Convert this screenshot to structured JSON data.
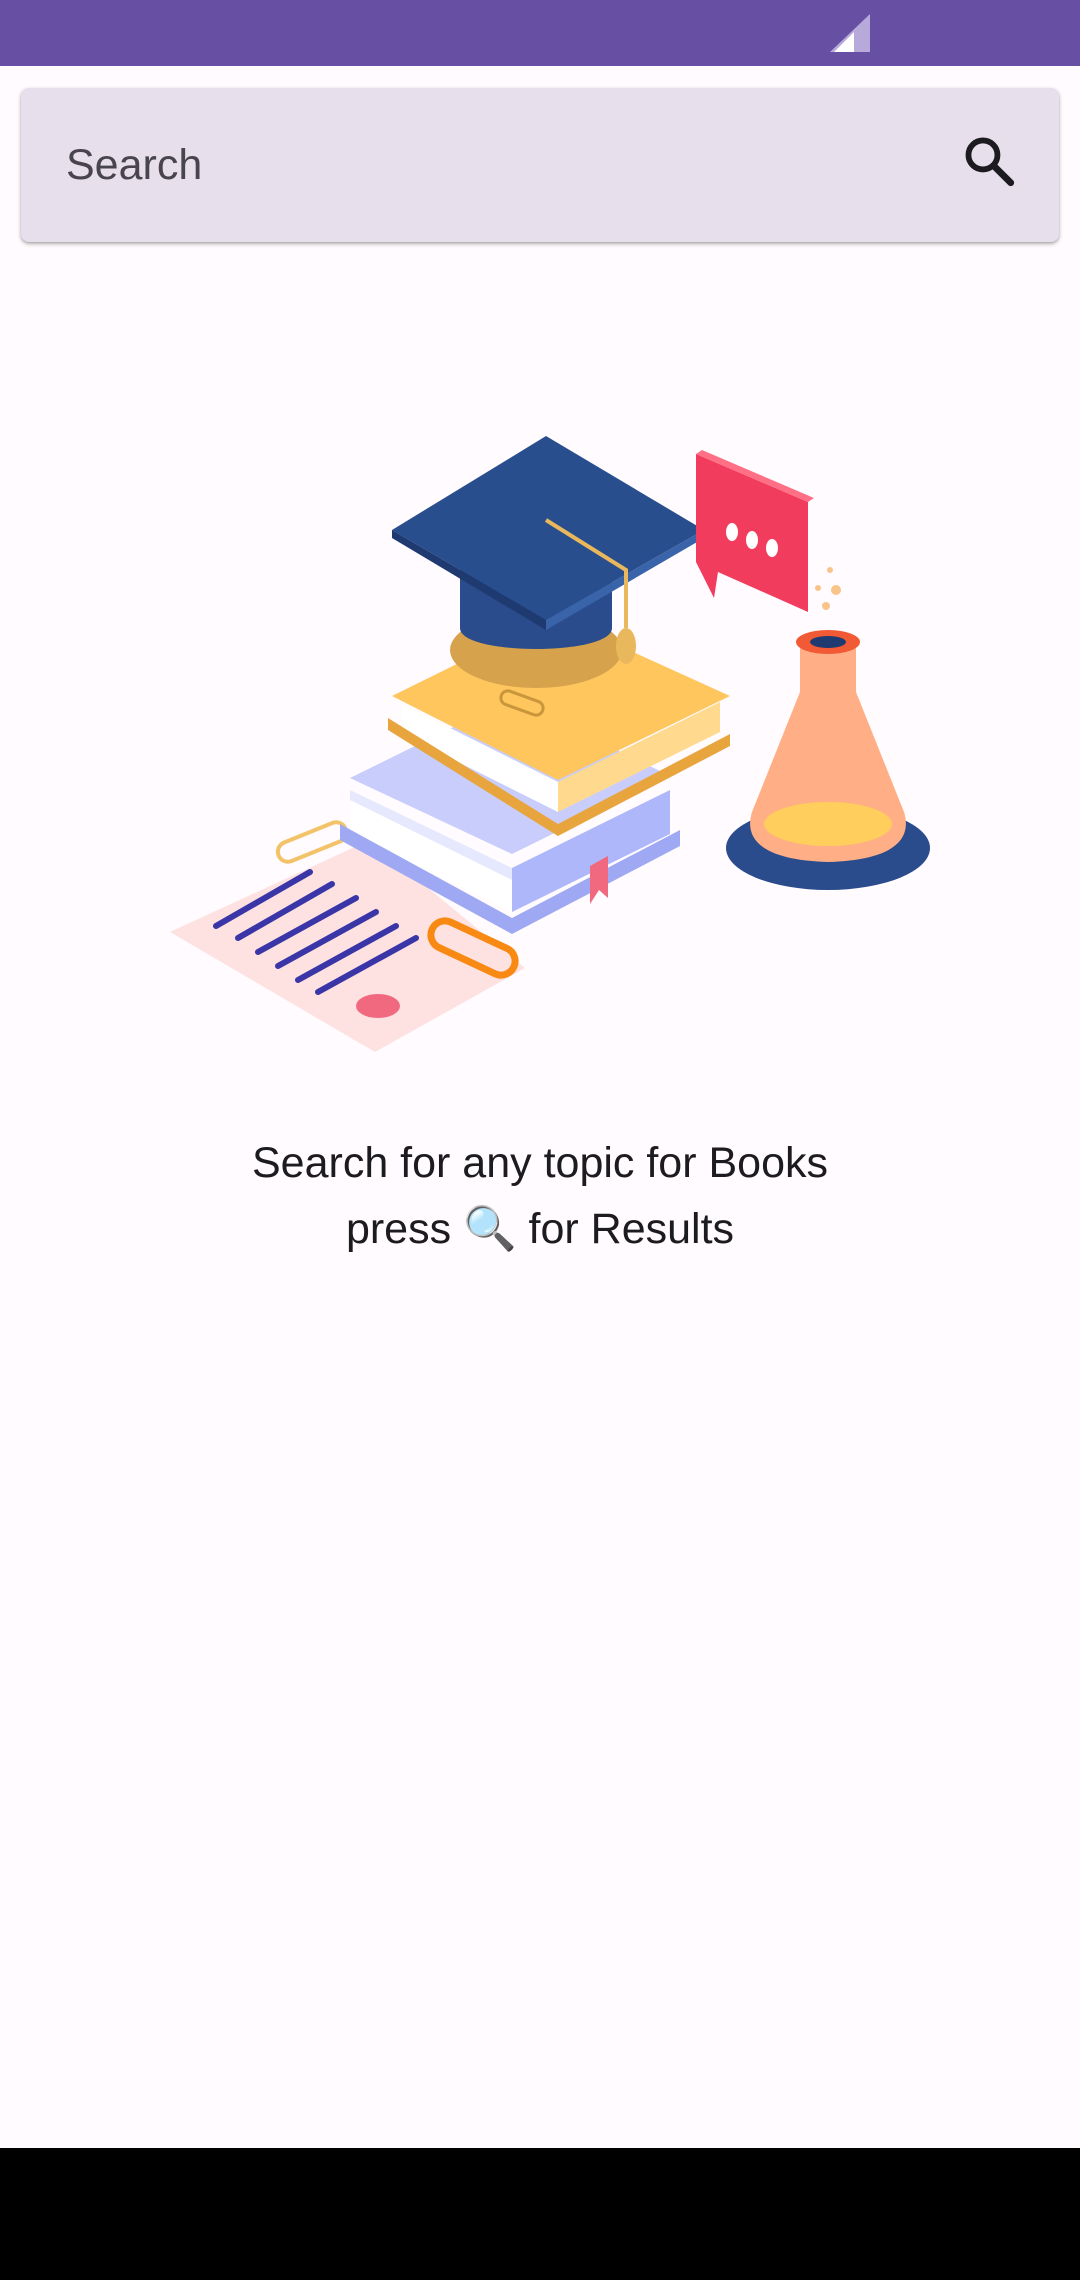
{
  "status_bar": {
    "color": "#6750A4",
    "icons": [
      "signal-icon"
    ]
  },
  "search": {
    "placeholder": "Search",
    "value": "",
    "icon": "search-icon"
  },
  "empty_state": {
    "illustration": "education-illustration",
    "line1": "Search for any topic for Books",
    "line2_prefix": "press ",
    "line2_emoji": "🔍",
    "line2_suffix": " for Results"
  },
  "colors": {
    "accent": "#6750A4",
    "background": "#FFFBFE",
    "search_bar": "#E7E0EC",
    "text": "#1C1B1F"
  }
}
